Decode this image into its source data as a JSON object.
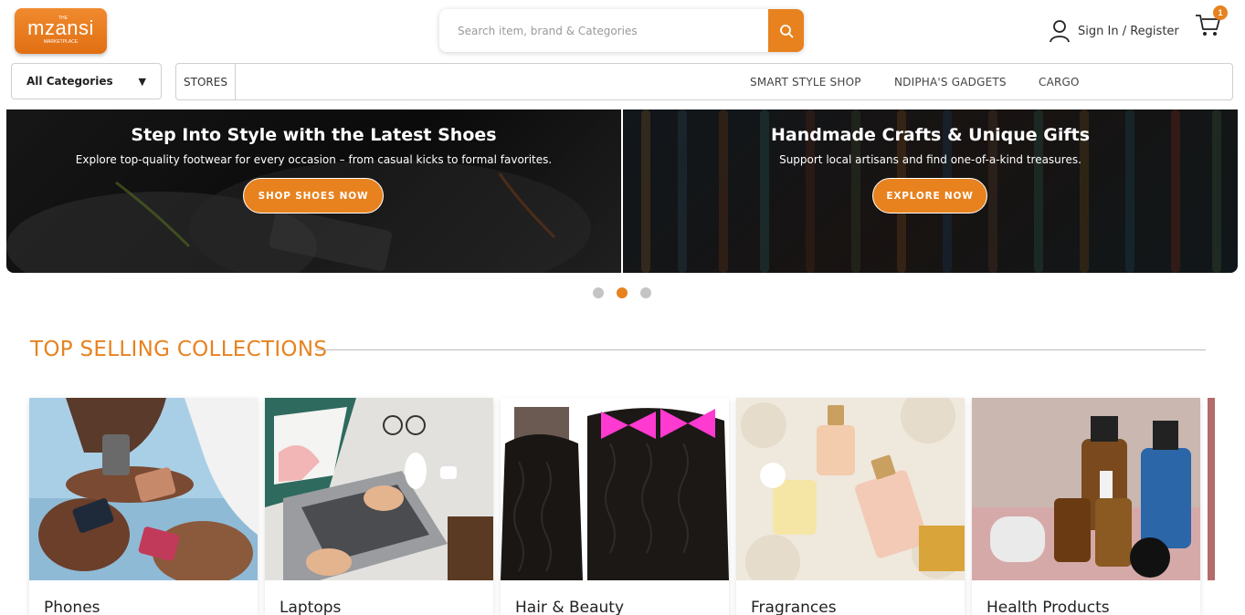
{
  "header": {
    "logo": {
      "the": "THE",
      "main": "mzansi",
      "sub": "MARKETPLACE"
    },
    "search": {
      "placeholder": "Search item, brand & Categories"
    },
    "signin": {
      "sign_in": "Sign In",
      "separator": "/",
      "register": "Register"
    },
    "cart": {
      "count": "1"
    }
  },
  "nav": {
    "category_select": "All Categories",
    "stores_label": "STORES",
    "stores": [
      "SMART STYLE SHOP",
      "NDIPHA'S GADGETS",
      "CARGO"
    ]
  },
  "banners": [
    {
      "title": "Step Into Style with the Latest Shoes",
      "subtitle": "Explore top-quality footwear for every occasion – from casual kicks to formal favorites.",
      "cta": "SHOP SHOES NOW"
    },
    {
      "title": "Handmade Crafts & Unique Gifts",
      "subtitle": "Support local artisans and find one-of-a-kind treasures.",
      "cta": "EXPLORE NOW"
    }
  ],
  "carousel": {
    "active_index": 2,
    "count": 3
  },
  "collections": {
    "title": "TOP SELLING COLLECTIONS",
    "items": [
      {
        "name": "Phones"
      },
      {
        "name": "Laptops"
      },
      {
        "name": "Hair & Beauty"
      },
      {
        "name": "Fragrances"
      },
      {
        "name": "Health Products"
      }
    ]
  },
  "colors": {
    "accent": "#e7821f",
    "border": "#cfcfcf"
  }
}
